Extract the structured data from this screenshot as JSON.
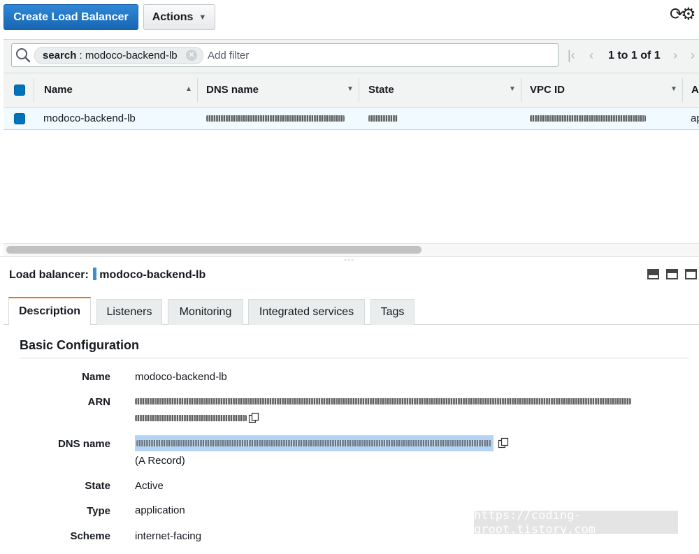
{
  "toolbar": {
    "create_label": "Create Load Balancer",
    "actions_label": "Actions"
  },
  "filter": {
    "chip_key": "search",
    "chip_value": "modoco-backend-lb",
    "placeholder": "Add filter",
    "pagination": "1 to 1 of 1"
  },
  "table": {
    "columns": [
      "Name",
      "DNS name",
      "State",
      "VPC ID",
      "A"
    ],
    "rows": [
      {
        "name": "modoco-backend-lb",
        "last_col": "ap"
      }
    ]
  },
  "details": {
    "prefix": "Load balancer:",
    "name": "modoco-backend-lb",
    "tabs": [
      "Description",
      "Listeners",
      "Monitoring",
      "Integrated services",
      "Tags"
    ],
    "section_title": "Basic Configuration",
    "fields": [
      {
        "label": "Name",
        "value": "modoco-backend-lb"
      },
      {
        "label": "ARN",
        "value": ""
      },
      {
        "label": "DNS name",
        "value": "",
        "sub": "(A Record)"
      },
      {
        "label": "State",
        "value": "Active"
      },
      {
        "label": "Type",
        "value": "application"
      },
      {
        "label": "Scheme",
        "value": "internet-facing"
      }
    ]
  },
  "watermark": "https://coding-groot.tistory.com",
  "colors": {
    "primary": "#1866b4",
    "selected_row": "#f1faff",
    "active_tab": "#ec7211",
    "highlight": "#b3d4f5"
  },
  "icons": [
    "search-icon",
    "refresh-icon",
    "settings-icon",
    "copy-icon",
    "chevron-down-icon",
    "first-page-icon",
    "prev-page-icon",
    "next-page-icon"
  ]
}
